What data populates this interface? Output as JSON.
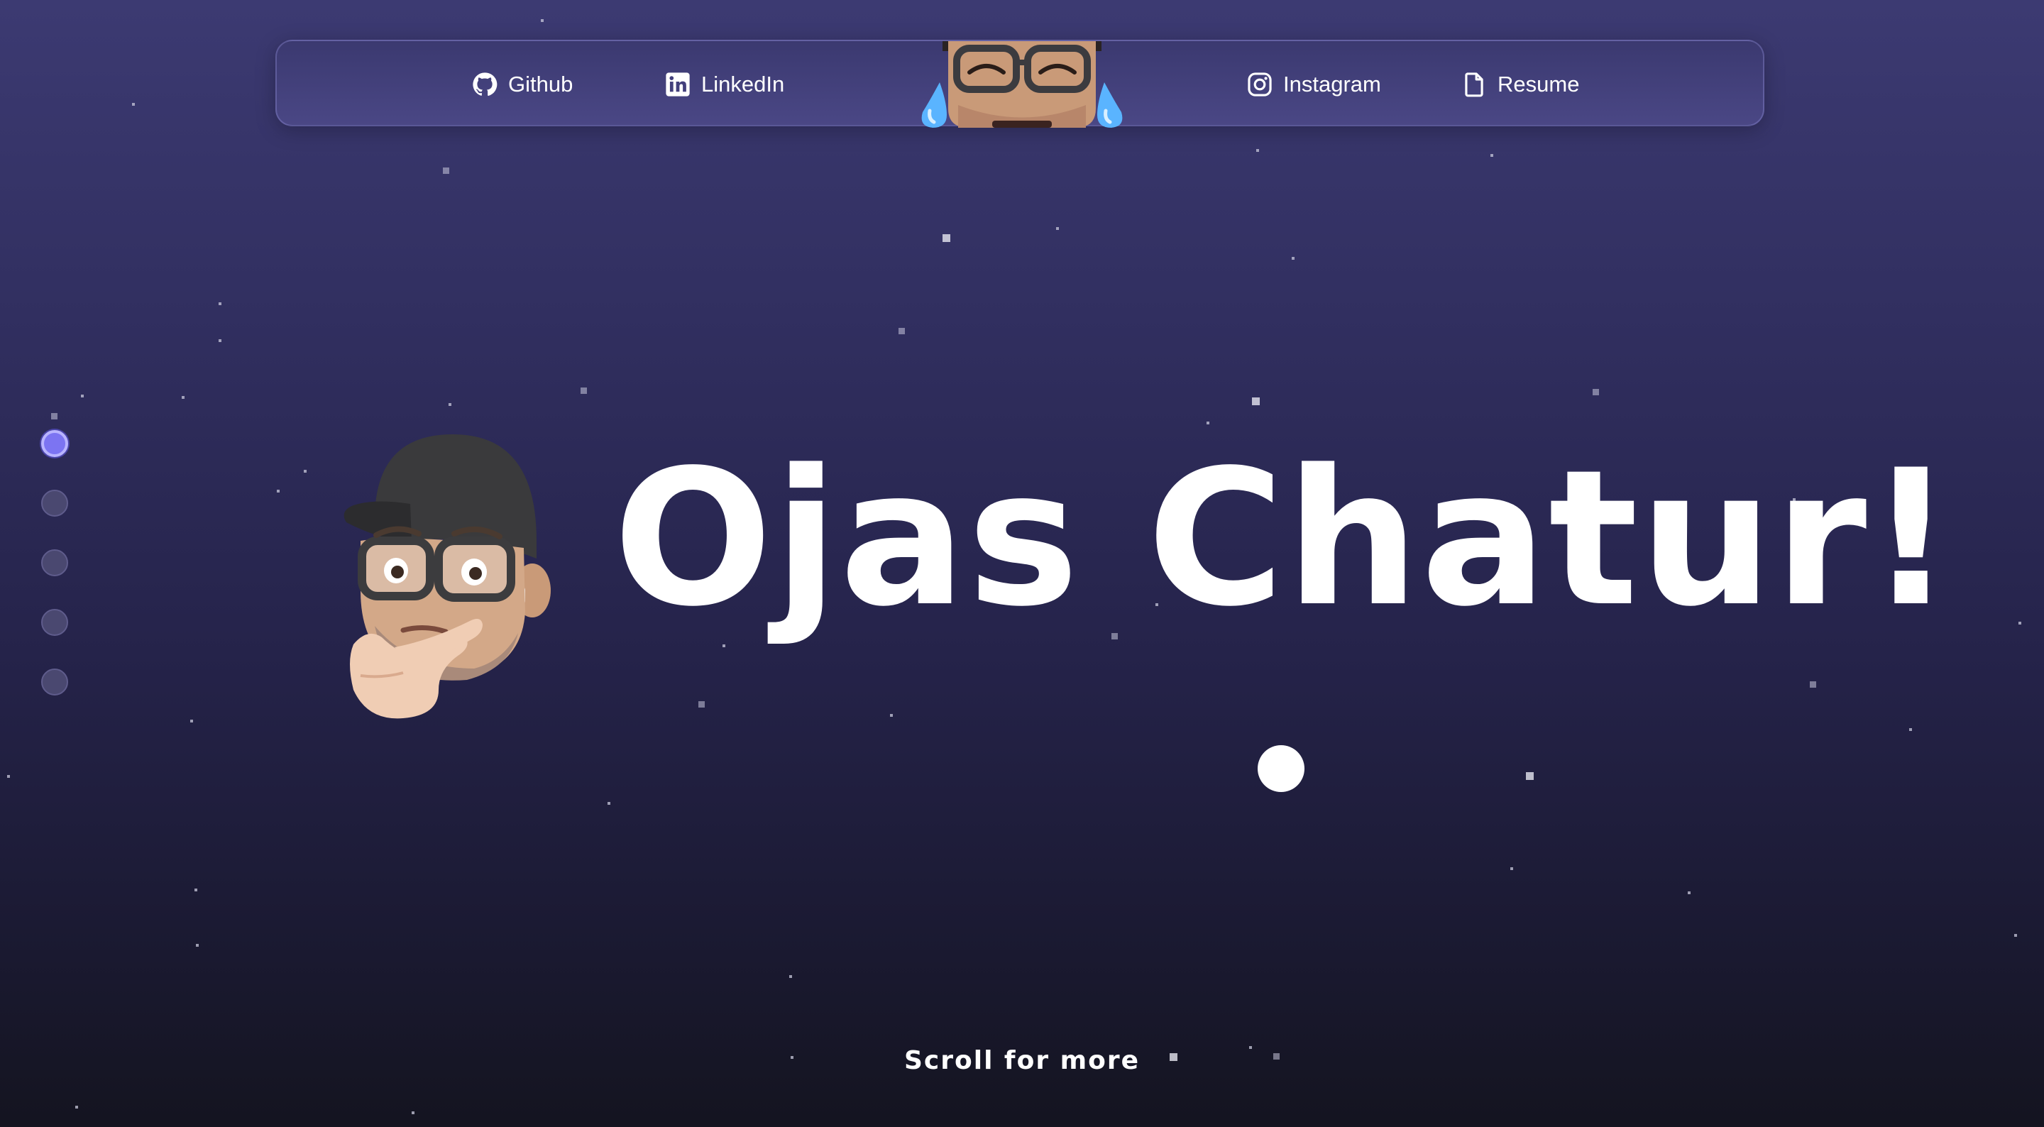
{
  "nav": {
    "links": [
      {
        "label": "Github",
        "icon": "github-icon"
      },
      {
        "label": "LinkedIn",
        "icon": "linkedin-icon"
      },
      {
        "label": "Instagram",
        "icon": "instagram-icon"
      },
      {
        "label": "Resume",
        "icon": "document-icon"
      }
    ],
    "center_avatar": "laughing-memoji-avatar"
  },
  "sections": {
    "count": 5,
    "active_index": 0
  },
  "hero": {
    "title": "Ojas Chatur!",
    "avatar": "thinking-memoji-avatar"
  },
  "scroll_hint": "Scroll for more",
  "colors": {
    "background_top": "#3c3a72",
    "background_bottom": "#141420",
    "navbar": "#423f7c",
    "active_dot": "#7c74f2",
    "text": "#ffffff"
  }
}
